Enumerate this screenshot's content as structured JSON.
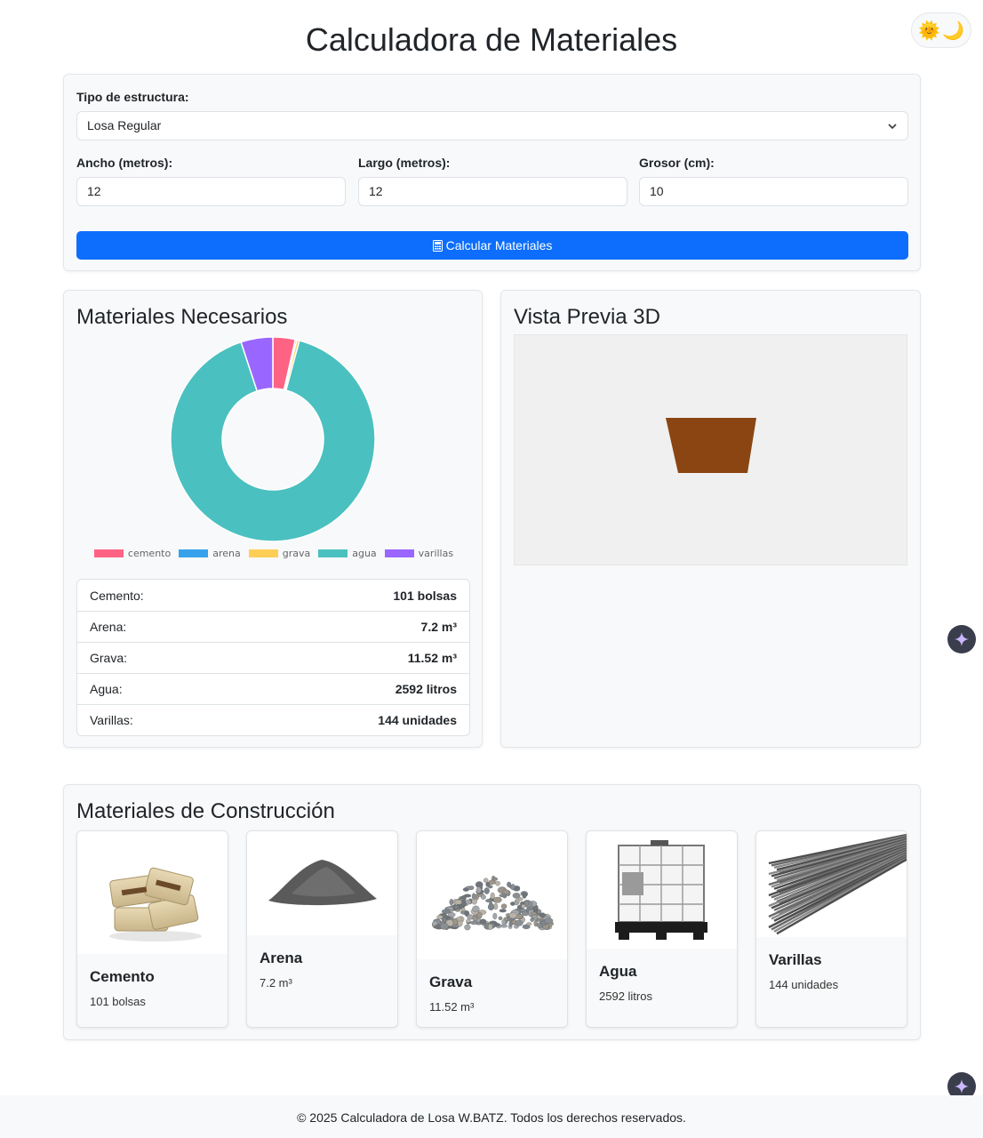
{
  "header": {
    "title": "Calculadora de Materiales",
    "theme_sun": "🌞",
    "theme_moon": "🌙"
  },
  "form": {
    "structure_label": "Tipo de estructura:",
    "structure_value": "Losa Regular",
    "width_label": "Ancho (metros):",
    "width_value": "12",
    "length_label": "Largo (metros):",
    "length_value": "12",
    "thickness_label": "Grosor (cm):",
    "thickness_value": "10",
    "calc_button": "Calcular Materiales"
  },
  "materials_card": {
    "title": "Materiales Necesarios",
    "rows": [
      {
        "label": "Cemento:",
        "value": "101 bolsas"
      },
      {
        "label": "Arena:",
        "value": "7.2 m³"
      },
      {
        "label": "Grava:",
        "value": "11.52 m³"
      },
      {
        "label": "Agua:",
        "value": "2592 litros"
      },
      {
        "label": "Varillas:",
        "value": "144 unidades"
      }
    ]
  },
  "chart_data": {
    "type": "pie",
    "variant": "doughnut",
    "categories": [
      "cemento",
      "arena",
      "grava",
      "agua",
      "varillas"
    ],
    "values": [
      101,
      7.2,
      11.52,
      2592,
      144
    ],
    "colors": [
      "#ff6384",
      "#36a2eb",
      "#ffce56",
      "#4bc0c0",
      "#9966ff"
    ],
    "legend": "bottom",
    "title": ""
  },
  "preview_card": {
    "title": "Vista Previa 3D",
    "slab_color": "#8b4513"
  },
  "construction": {
    "title": "Materiales de Construcción",
    "items": [
      {
        "name": "Cemento",
        "qty": "101 bolsas",
        "icon": "cement-bags-icon"
      },
      {
        "name": "Arena",
        "qty": "7.2 m³",
        "icon": "sand-pile-icon"
      },
      {
        "name": "Grava",
        "qty": "11.52 m³",
        "icon": "gravel-pile-icon"
      },
      {
        "name": "Agua",
        "qty": "2592 litros",
        "icon": "water-tank-icon"
      },
      {
        "name": "Varillas",
        "qty": "144 unidades",
        "icon": "rebar-bundle-icon"
      }
    ]
  },
  "footer": {
    "text": "© 2025 Calculadora de Losa W.BATZ. Todos los derechos reservados."
  },
  "colors": {
    "primary": "#0d6efd",
    "card_bg": "#f8f9fa"
  }
}
